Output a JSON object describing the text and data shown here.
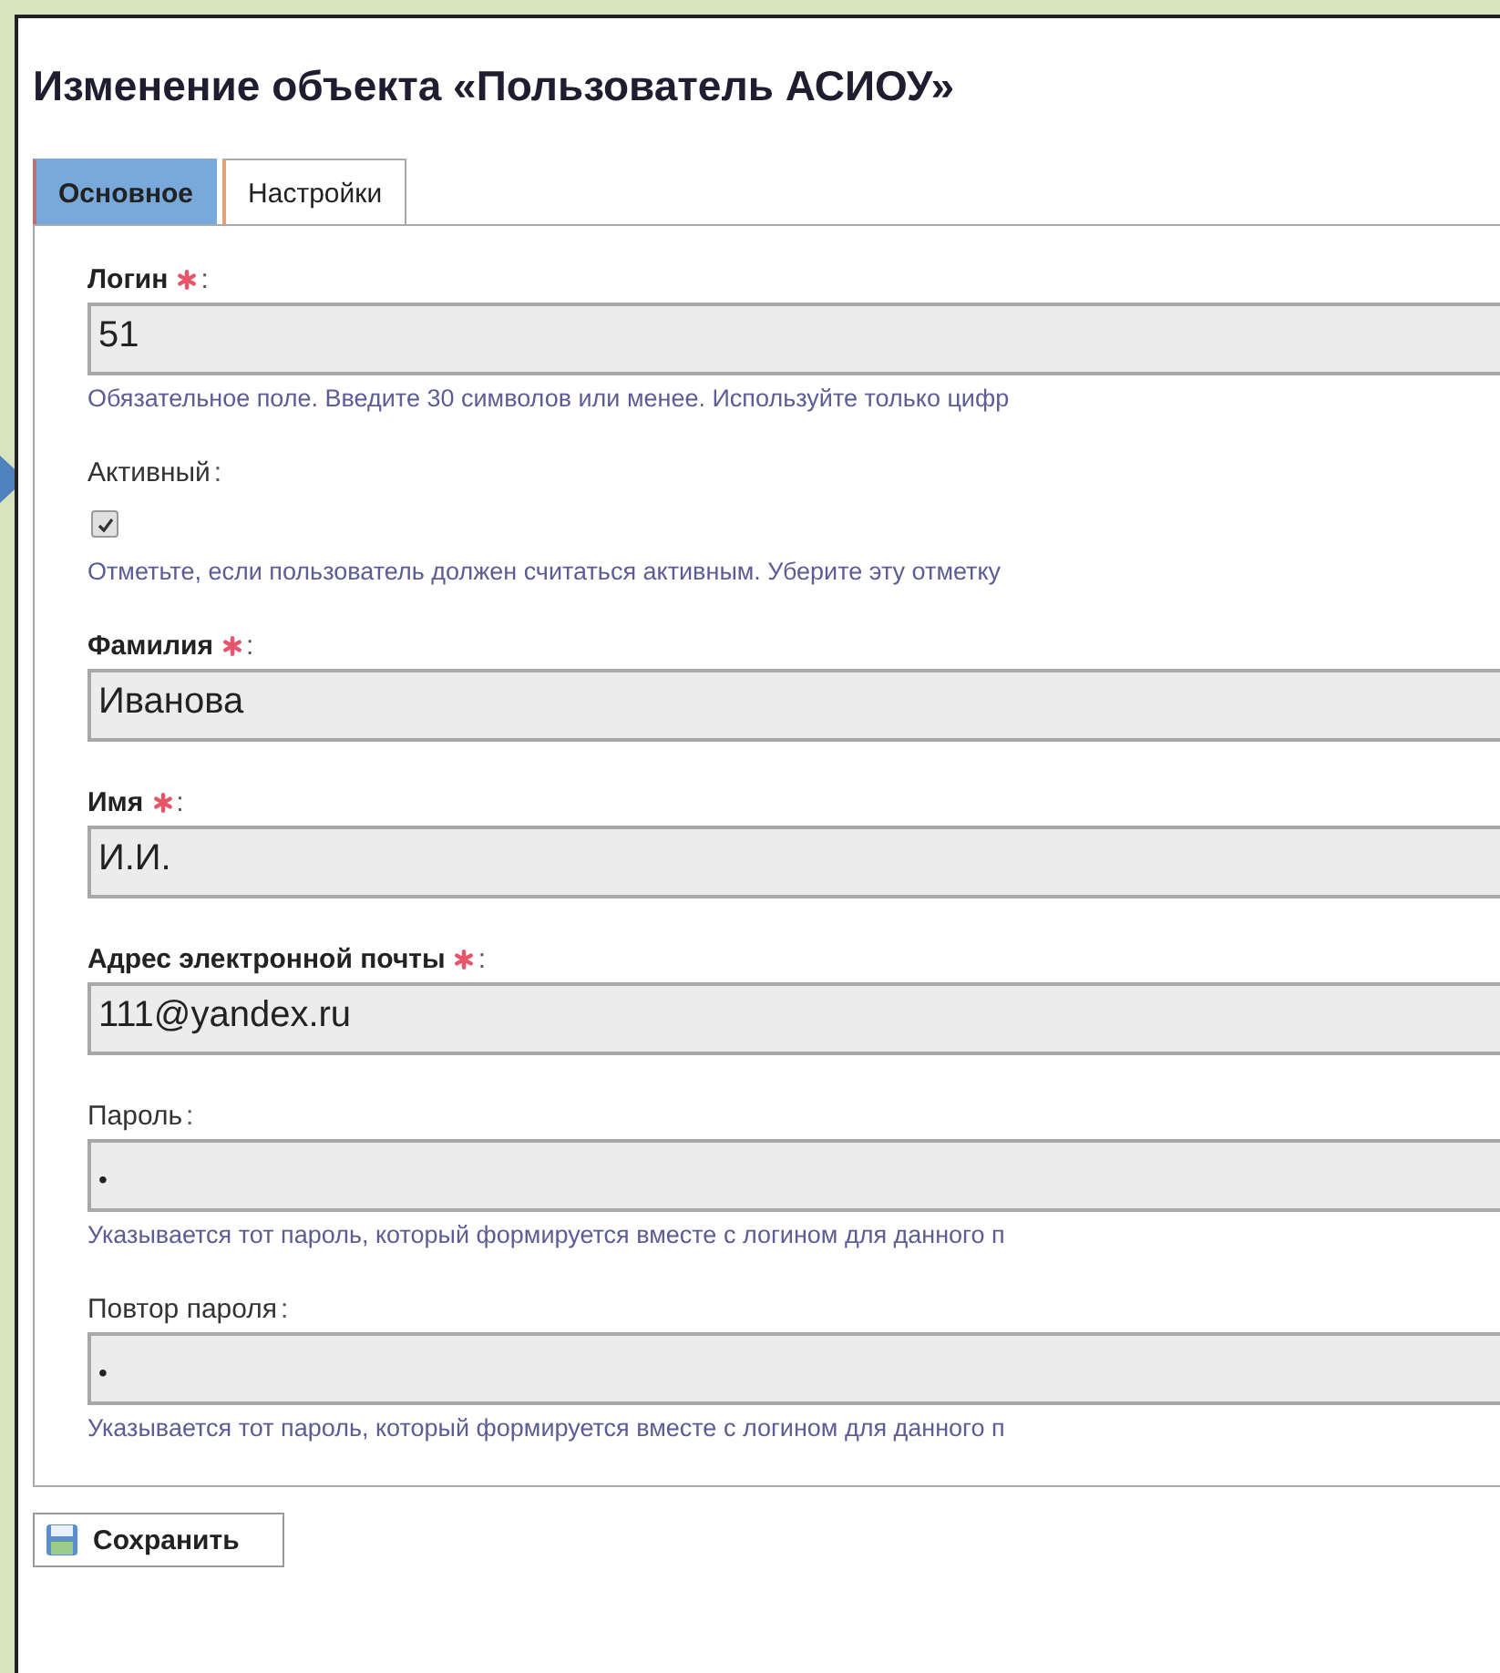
{
  "title": "Изменение объекта «Пользователь АСИОУ»",
  "tabs": [
    {
      "label": "Основное",
      "selected": true
    },
    {
      "label": "Настройки",
      "selected": false
    }
  ],
  "fields": [
    {
      "kind": "text",
      "label": "Логин",
      "colon": ":",
      "required": true,
      "value": "51",
      "hint": "Обязательное поле. Введите 30 символов или менее. Используйте только цифр"
    },
    {
      "kind": "checkbox",
      "label": "Активный",
      "colon": ":",
      "required": false,
      "checked": true,
      "hint": "Отметьте, если пользователь должен считаться активным. Уберите эту отметку"
    },
    {
      "kind": "text",
      "label": "Фамилия",
      "colon": ":",
      "required": true,
      "value": "Иванова"
    },
    {
      "kind": "text",
      "label": "Имя",
      "colon": ":",
      "required": true,
      "value": "И.И."
    },
    {
      "kind": "text",
      "label": "Адрес электронной почты",
      "colon": ":",
      "required": true,
      "value": "111@yandex.ru"
    },
    {
      "kind": "password",
      "label": "Пароль",
      "colon": ":",
      "required": false,
      "value": "•",
      "hint": "Указывается тот пароль, который формируется вместе с логином для данного п"
    },
    {
      "kind": "password",
      "label": "Повтор пароля",
      "colon": ":",
      "required": false,
      "value": "•",
      "hint": "Указывается тот пароль, который формируется вместе с логином для данного п"
    }
  ],
  "save_button": "Сохранить"
}
